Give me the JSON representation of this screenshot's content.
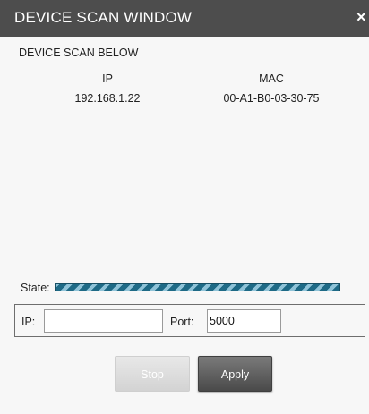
{
  "window": {
    "title": "DEVICE SCAN WINDOW",
    "close_glyph": "×"
  },
  "scan": {
    "heading": "DEVICE SCAN BELOW",
    "columns": [
      "IP",
      "MAC"
    ],
    "rows": [
      {
        "ip": "192.168.1.22",
        "mac": "00-A1-B0-03-30-75"
      }
    ]
  },
  "state": {
    "label": "State:",
    "progress_fraction": 1.0
  },
  "connection": {
    "ip_label": "IP:",
    "ip_value": "",
    "port_label": "Port:",
    "port_value": "5000"
  },
  "buttons": {
    "stop_label": "Stop",
    "apply_label": "Apply"
  },
  "colors": {
    "titlebar": "#4d4d4d",
    "progress": "#1e6a86",
    "apply_button": "#5a5a5a"
  },
  "icons": {
    "close": "close-icon"
  }
}
